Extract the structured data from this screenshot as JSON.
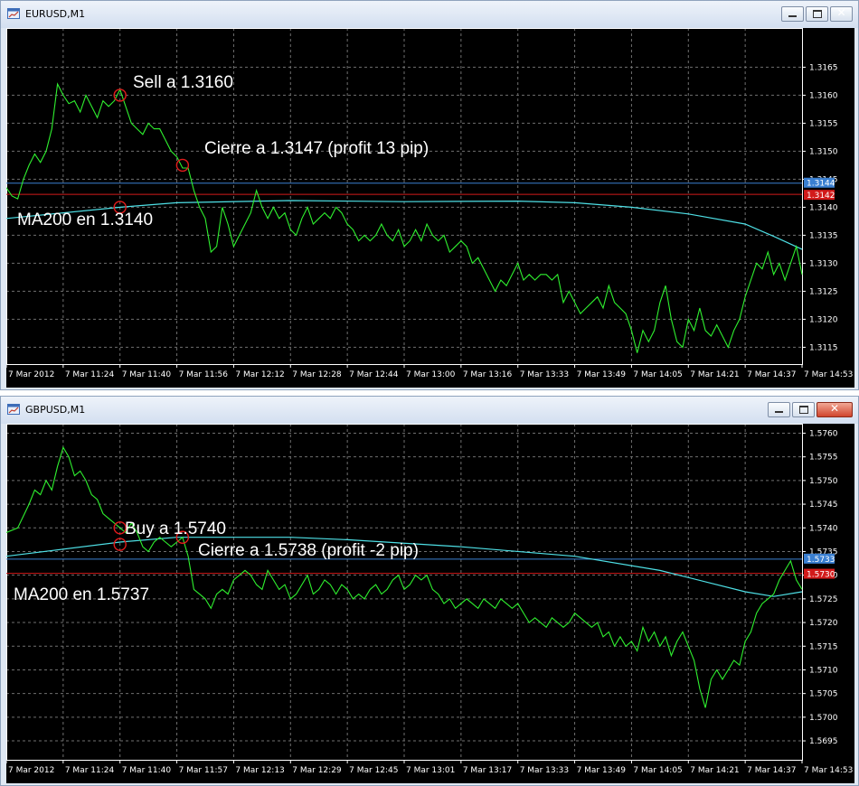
{
  "windows": [
    {
      "title": "EURUSD,M1",
      "price_ticks": [
        "1.3165",
        "1.3160",
        "1.3155",
        "1.3150",
        "1.3145",
        "1.3140",
        "1.3135",
        "1.3130",
        "1.3125",
        "1.3120",
        "1.3115"
      ],
      "time_ticks": [
        "7 Mar 2012",
        "7 Mar 11:24",
        "7 Mar 11:40",
        "7 Mar 11:56",
        "7 Mar 12:12",
        "7 Mar 12:28",
        "7 Mar 12:44",
        "7 Mar 13:00",
        "7 Mar 13:16",
        "7 Mar 13:33",
        "7 Mar 13:49",
        "7 Mar 14:05",
        "7 Mar 14:21",
        "7 Mar 14:37",
        "7 Mar 14:53"
      ],
      "ask_label": "1.3144",
      "bid_label": "1.3142",
      "annotations": [
        "Sell a 1.3160",
        "Cierre a 1.3147 (profit 13 pip)",
        "MA200 en 1.3140"
      ],
      "ylim": [
        1.3112,
        1.3172
      ],
      "ask": 1.31443,
      "bid": 1.31423,
      "markers": [
        [
          20,
          1.316
        ],
        [
          31,
          1.31475
        ],
        [
          20,
          1.314
        ]
      ],
      "ma": [
        [
          0,
          1.3138
        ],
        [
          20,
          1.314
        ],
        [
          30,
          1.31408
        ],
        [
          50,
          1.31412
        ],
        [
          70,
          1.3141
        ],
        [
          90,
          1.31411
        ],
        [
          100,
          1.31408
        ],
        [
          110,
          1.314
        ],
        [
          120,
          1.31388
        ],
        [
          130,
          1.3137
        ],
        [
          135,
          1.31348
        ],
        [
          140,
          1.31325
        ]
      ],
      "price": [
        [
          0,
          1.31435
        ],
        [
          1,
          1.3142
        ],
        [
          2,
          1.31415
        ],
        [
          3,
          1.3145
        ],
        [
          4,
          1.31475
        ],
        [
          5,
          1.31495
        ],
        [
          6,
          1.3148
        ],
        [
          7,
          1.315
        ],
        [
          8,
          1.3154
        ],
        [
          9,
          1.3162
        ],
        [
          10,
          1.316
        ],
        [
          11,
          1.31585
        ],
        [
          12,
          1.3159
        ],
        [
          13,
          1.3157
        ],
        [
          14,
          1.316
        ],
        [
          15,
          1.3158
        ],
        [
          16,
          1.3156
        ],
        [
          17,
          1.3159
        ],
        [
          18,
          1.3158
        ],
        [
          19,
          1.3159
        ],
        [
          20,
          1.3161
        ],
        [
          21,
          1.3158
        ],
        [
          22,
          1.3155
        ],
        [
          23,
          1.3154
        ],
        [
          24,
          1.3153
        ],
        [
          25,
          1.3155
        ],
        [
          26,
          1.3154
        ],
        [
          27,
          1.3154
        ],
        [
          28,
          1.3152
        ],
        [
          29,
          1.315
        ],
        [
          30,
          1.3149
        ],
        [
          31,
          1.3147
        ],
        [
          32,
          1.3147
        ],
        [
          33,
          1.3143
        ],
        [
          34,
          1.314
        ],
        [
          35,
          1.3138
        ],
        [
          36,
          1.3132
        ],
        [
          37,
          1.3133
        ],
        [
          38,
          1.314
        ],
        [
          39,
          1.3137
        ],
        [
          40,
          1.3133
        ],
        [
          41,
          1.3135
        ],
        [
          42,
          1.3137
        ],
        [
          43,
          1.3139
        ],
        [
          44,
          1.3143
        ],
        [
          45,
          1.314
        ],
        [
          46,
          1.3138
        ],
        [
          47,
          1.314
        ],
        [
          48,
          1.3138
        ],
        [
          49,
          1.3139
        ],
        [
          50,
          1.3136
        ],
        [
          51,
          1.3135
        ],
        [
          52,
          1.3138
        ],
        [
          53,
          1.314
        ],
        [
          54,
          1.3137
        ],
        [
          55,
          1.3138
        ],
        [
          56,
          1.3139
        ],
        [
          57,
          1.3138
        ],
        [
          58,
          1.314
        ],
        [
          59,
          1.3139
        ],
        [
          60,
          1.3137
        ],
        [
          61,
          1.3136
        ],
        [
          62,
          1.3134
        ],
        [
          63,
          1.3135
        ],
        [
          64,
          1.3134
        ],
        [
          65,
          1.3135
        ],
        [
          66,
          1.3137
        ],
        [
          67,
          1.3135
        ],
        [
          68,
          1.3134
        ],
        [
          69,
          1.3136
        ],
        [
          70,
          1.3133
        ],
        [
          71,
          1.3134
        ],
        [
          72,
          1.3136
        ],
        [
          73,
          1.3134
        ],
        [
          74,
          1.3137
        ],
        [
          75,
          1.3135
        ],
        [
          76,
          1.3134
        ],
        [
          77,
          1.3135
        ],
        [
          78,
          1.3132
        ],
        [
          79,
          1.3133
        ],
        [
          80,
          1.3134
        ],
        [
          81,
          1.3133
        ],
        [
          82,
          1.313
        ],
        [
          83,
          1.3131
        ],
        [
          84,
          1.3129
        ],
        [
          85,
          1.3127
        ],
        [
          86,
          1.3125
        ],
        [
          87,
          1.3127
        ],
        [
          88,
          1.3126
        ],
        [
          89,
          1.3128
        ],
        [
          90,
          1.313
        ],
        [
          91,
          1.3127
        ],
        [
          92,
          1.3128
        ],
        [
          93,
          1.3127
        ],
        [
          94,
          1.3128
        ],
        [
          95,
          1.3128
        ],
        [
          96,
          1.3127
        ],
        [
          97,
          1.3128
        ],
        [
          98,
          1.3123
        ],
        [
          99,
          1.3125
        ],
        [
          100,
          1.3123
        ],
        [
          101,
          1.3121
        ],
        [
          102,
          1.3122
        ],
        [
          103,
          1.3123
        ],
        [
          104,
          1.3124
        ],
        [
          105,
          1.3122
        ],
        [
          106,
          1.3126
        ],
        [
          107,
          1.3123
        ],
        [
          108,
          1.3122
        ],
        [
          109,
          1.3121
        ],
        [
          110,
          1.3118
        ],
        [
          111,
          1.3114
        ],
        [
          112,
          1.3118
        ],
        [
          113,
          1.3116
        ],
        [
          114,
          1.3118
        ],
        [
          115,
          1.3123
        ],
        [
          116,
          1.3126
        ],
        [
          117,
          1.312
        ],
        [
          118,
          1.3116
        ],
        [
          119,
          1.3115
        ],
        [
          120,
          1.312
        ],
        [
          121,
          1.3118
        ],
        [
          122,
          1.3122
        ],
        [
          123,
          1.3118
        ],
        [
          124,
          1.3117
        ],
        [
          125,
          1.3119
        ],
        [
          126,
          1.3117
        ],
        [
          127,
          1.3115
        ],
        [
          128,
          1.3118
        ],
        [
          129,
          1.312
        ],
        [
          130,
          1.3124
        ],
        [
          131,
          1.3127
        ],
        [
          132,
          1.313
        ],
        [
          133,
          1.3129
        ],
        [
          134,
          1.3132
        ],
        [
          135,
          1.3128
        ],
        [
          136,
          1.313
        ],
        [
          137,
          1.3127
        ],
        [
          138,
          1.313
        ],
        [
          139,
          1.3133
        ],
        [
          140,
          1.3128
        ]
      ]
    },
    {
      "title": "GBPUSD,M1",
      "price_ticks": [
        "1.5760",
        "1.5755",
        "1.5750",
        "1.5745",
        "1.5740",
        "1.5735",
        "1.5730",
        "1.5725",
        "1.5720",
        "1.5715",
        "1.5710",
        "1.5705",
        "1.5700",
        "1.5695"
      ],
      "time_ticks": [
        "7 Mar 2012",
        "7 Mar 11:24",
        "7 Mar 11:40",
        "7 Mar 11:57",
        "7 Mar 12:13",
        "7 Mar 12:29",
        "7 Mar 12:45",
        "7 Mar 13:01",
        "7 Mar 13:17",
        "7 Mar 13:33",
        "7 Mar 13:49",
        "7 Mar 14:05",
        "7 Mar 14:21",
        "7 Mar 14:37",
        "7 Mar 14:53"
      ],
      "ask_label": "1.5733",
      "bid_label": "1.5730",
      "annotations": [
        "Buy a 1.5740",
        "Cierre a 1.5738 (profit -2 pip)",
        "MA200 en 1.5737"
      ],
      "ylim": [
        1.5691,
        1.5762
      ],
      "ask": 1.57334,
      "bid": 1.57304,
      "markers": [
        [
          20,
          1.574
        ],
        [
          31,
          1.5738
        ],
        [
          20,
          1.57365
        ]
      ],
      "ma": [
        [
          0,
          1.5734
        ],
        [
          20,
          1.5737
        ],
        [
          30,
          1.5738
        ],
        [
          50,
          1.5738
        ],
        [
          60,
          1.57375
        ],
        [
          80,
          1.5736
        ],
        [
          100,
          1.5734
        ],
        [
          115,
          1.5731
        ],
        [
          130,
          1.57265
        ],
        [
          135,
          1.57255
        ],
        [
          140,
          1.57265
        ]
      ],
      "price": [
        [
          0,
          1.5739
        ],
        [
          2,
          1.574
        ],
        [
          4,
          1.5745
        ],
        [
          5,
          1.5748
        ],
        [
          6,
          1.5747
        ],
        [
          7,
          1.575
        ],
        [
          8,
          1.5748
        ],
        [
          9,
          1.5753
        ],
        [
          10,
          1.5757
        ],
        [
          11,
          1.5755
        ],
        [
          12,
          1.5751
        ],
        [
          13,
          1.5752
        ],
        [
          14,
          1.575
        ],
        [
          15,
          1.5747
        ],
        [
          16,
          1.5746
        ],
        [
          17,
          1.5743
        ],
        [
          18,
          1.5742
        ],
        [
          19,
          1.5741
        ],
        [
          20,
          1.574
        ],
        [
          21,
          1.5739
        ],
        [
          22,
          1.5741
        ],
        [
          23,
          1.5739
        ],
        [
          24,
          1.5736
        ],
        [
          25,
          1.5735
        ],
        [
          26,
          1.5737
        ],
        [
          27,
          1.5738
        ],
        [
          28,
          1.5737
        ],
        [
          29,
          1.5736
        ],
        [
          30,
          1.5737
        ],
        [
          31,
          1.5738
        ],
        [
          32,
          1.5734
        ],
        [
          33,
          1.5727
        ],
        [
          34,
          1.5726
        ],
        [
          35,
          1.5725
        ],
        [
          36,
          1.5723
        ],
        [
          37,
          1.5726
        ],
        [
          38,
          1.5727
        ],
        [
          39,
          1.5726
        ],
        [
          40,
          1.5729
        ],
        [
          41,
          1.573
        ],
        [
          42,
          1.5731
        ],
        [
          43,
          1.573
        ],
        [
          44,
          1.5728
        ],
        [
          45,
          1.5727
        ],
        [
          46,
          1.5731
        ],
        [
          47,
          1.5729
        ],
        [
          48,
          1.5727
        ],
        [
          49,
          1.5728
        ],
        [
          50,
          1.5725
        ],
        [
          51,
          1.5726
        ],
        [
          52,
          1.5728
        ],
        [
          53,
          1.573
        ],
        [
          54,
          1.5726
        ],
        [
          55,
          1.5727
        ],
        [
          56,
          1.5729
        ],
        [
          57,
          1.5728
        ],
        [
          58,
          1.5726
        ],
        [
          59,
          1.5728
        ],
        [
          60,
          1.5727
        ],
        [
          61,
          1.5725
        ],
        [
          62,
          1.5726
        ],
        [
          63,
          1.5725
        ],
        [
          64,
          1.5727
        ],
        [
          65,
          1.5728
        ],
        [
          66,
          1.5726
        ],
        [
          67,
          1.5727
        ],
        [
          68,
          1.5729
        ],
        [
          69,
          1.573
        ],
        [
          70,
          1.5727
        ],
        [
          71,
          1.5728
        ],
        [
          72,
          1.573
        ],
        [
          73,
          1.5729
        ],
        [
          74,
          1.573
        ],
        [
          75,
          1.5727
        ],
        [
          76,
          1.5726
        ],
        [
          77,
          1.5724
        ],
        [
          78,
          1.5725
        ],
        [
          79,
          1.5723
        ],
        [
          80,
          1.5724
        ],
        [
          81,
          1.5725
        ],
        [
          82,
          1.5724
        ],
        [
          83,
          1.5723
        ],
        [
          84,
          1.5725
        ],
        [
          85,
          1.5724
        ],
        [
          86,
          1.5723
        ],
        [
          87,
          1.5725
        ],
        [
          88,
          1.5724
        ],
        [
          89,
          1.5723
        ],
        [
          90,
          1.5724
        ],
        [
          91,
          1.5722
        ],
        [
          92,
          1.572
        ],
        [
          93,
          1.5721
        ],
        [
          94,
          1.572
        ],
        [
          95,
          1.5719
        ],
        [
          96,
          1.5721
        ],
        [
          97,
          1.572
        ],
        [
          98,
          1.5719
        ],
        [
          99,
          1.572
        ],
        [
          100,
          1.5722
        ],
        [
          101,
          1.5721
        ],
        [
          102,
          1.572
        ],
        [
          103,
          1.5719
        ],
        [
          104,
          1.572
        ],
        [
          105,
          1.5717
        ],
        [
          106,
          1.5718
        ],
        [
          107,
          1.5715
        ],
        [
          108,
          1.5717
        ],
        [
          109,
          1.5715
        ],
        [
          110,
          1.5716
        ],
        [
          111,
          1.5714
        ],
        [
          112,
          1.5719
        ],
        [
          113,
          1.5716
        ],
        [
          114,
          1.5718
        ],
        [
          115,
          1.5715
        ],
        [
          116,
          1.5717
        ],
        [
          117,
          1.5713
        ],
        [
          118,
          1.5716
        ],
        [
          119,
          1.5718
        ],
        [
          120,
          1.5715
        ],
        [
          121,
          1.5712
        ],
        [
          122,
          1.5706
        ],
        [
          123,
          1.5702
        ],
        [
          124,
          1.5708
        ],
        [
          125,
          1.571
        ],
        [
          126,
          1.5708
        ],
        [
          127,
          1.571
        ],
        [
          128,
          1.5712
        ],
        [
          129,
          1.5711
        ],
        [
          130,
          1.5716
        ],
        [
          131,
          1.5718
        ],
        [
          132,
          1.5722
        ],
        [
          133,
          1.5724
        ],
        [
          134,
          1.5725
        ],
        [
          135,
          1.5726
        ],
        [
          136,
          1.5729
        ],
        [
          137,
          1.5731
        ],
        [
          138,
          1.5733
        ],
        [
          139,
          1.5729
        ],
        [
          140,
          1.5727
        ]
      ]
    }
  ],
  "colors": {
    "background": "#000000",
    "grid": "#6f6f6f",
    "price_line": "#2ff02f",
    "ma_line": "#4ee0e6",
    "bid_line": "#d21a1a",
    "ask_line": "#3a7fd1",
    "marker": "#e11c1c",
    "axis_text": "#ffffff"
  },
  "icons": {
    "window": "chart-window-icon",
    "minimize": "minimize-icon",
    "maximize": "maximize-icon",
    "close": "close-icon"
  }
}
